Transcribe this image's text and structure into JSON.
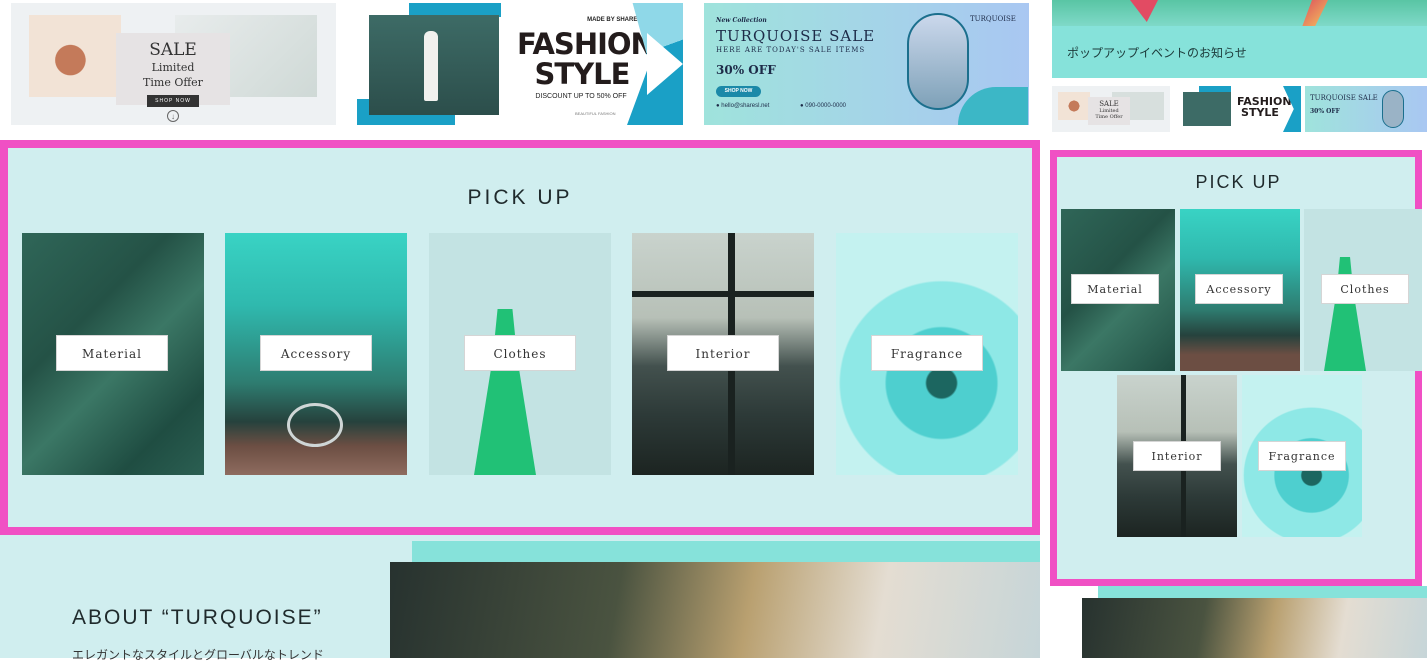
{
  "colors": {
    "accent_pink": "#f050c4",
    "turquoise": "#86e2da",
    "panel_bg": "#d0eeef"
  },
  "banners": {
    "sale": {
      "title": "SALE",
      "line1": "Limited",
      "line2": "Time Offer",
      "button": "SHOP NOW",
      "arrow_icon": "↓"
    },
    "fashion": {
      "made_by": "MADE BY SHARESL",
      "title_line1": "FASHION",
      "title_line2": "STYLE",
      "subtitle": "DISCOUNT UP TO 50% OFF",
      "footer": "BEAUTIFUL FASHION"
    },
    "turquoise": {
      "tagline": "New Collection",
      "title": "TURQUOISE SALE",
      "subtitle": "HERE ARE TODAY'S SALE ITEMS",
      "percent": "30% OFF",
      "button": "SHOP NOW",
      "email": "hello@sharesl.net",
      "phone": "090-0000-0000",
      "brand": "TURQUOISE"
    }
  },
  "right_top": {
    "notice": "ポップアップイベントのお知らせ"
  },
  "pickup": {
    "title": "PICK UP",
    "items": [
      {
        "label": "Material"
      },
      {
        "label": "Accessory"
      },
      {
        "label": "Clothes"
      },
      {
        "label": "Interior"
      },
      {
        "label": "Fragrance"
      }
    ]
  },
  "about": {
    "title": "ABOUT “TURQUOISE”",
    "text": "エレガントなスタイルとグローバルなトレンド"
  }
}
